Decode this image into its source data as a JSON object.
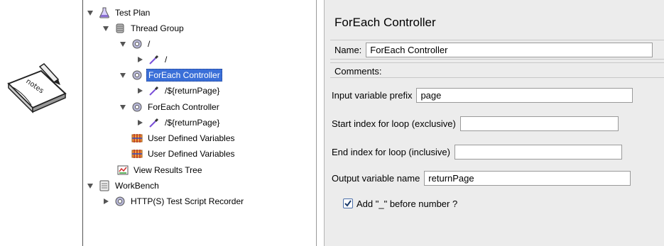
{
  "tree": {
    "items": [
      {
        "label": "Test Plan",
        "icon": "flask-icon",
        "toggle": "open"
      },
      {
        "label": "Thread Group",
        "icon": "spool-icon",
        "toggle": "open"
      },
      {
        "label": "/",
        "icon": "gear-icon",
        "toggle": "open"
      },
      {
        "label": "/",
        "icon": "pipette-icon",
        "toggle": "closed"
      },
      {
        "label": "ForEach Controller",
        "icon": "gear-icon",
        "toggle": "open",
        "selected": true
      },
      {
        "label": "/${returnPage}",
        "icon": "pipette-icon",
        "toggle": "closed"
      },
      {
        "label": "ForEach Controller",
        "icon": "gear-icon",
        "toggle": "open"
      },
      {
        "label": "/${returnPage}",
        "icon": "pipette-icon",
        "toggle": "closed"
      },
      {
        "label": "User Defined Variables",
        "icon": "variables-icon",
        "toggle": "none"
      },
      {
        "label": "User Defined Variables",
        "icon": "variables-icon",
        "toggle": "none"
      },
      {
        "label": "View Results Tree",
        "icon": "results-tree-icon",
        "toggle": "none"
      },
      {
        "label": "WorkBench",
        "icon": "clipboard-icon",
        "toggle": "open"
      },
      {
        "label": "HTTP(S) Test Script Recorder",
        "icon": "gear-icon",
        "toggle": "closed"
      }
    ]
  },
  "panel": {
    "title": "ForEach Controller",
    "name_label": "Name:",
    "name_value": "ForEach Controller",
    "comments_label": "Comments:",
    "input_prefix_label": "Input variable prefix",
    "input_prefix_value": "page",
    "start_index_label": "Start index for loop (exclusive)",
    "start_index_value": "",
    "end_index_label": "End index for loop (inclusive)",
    "end_index_value": "",
    "output_var_label": "Output variable name",
    "output_var_value": "returnPage",
    "add_underscore_label": "Add \"_\" before number ?",
    "add_underscore_checked": true
  },
  "decoration": {
    "notes_text": "notes"
  },
  "colors": {
    "selection": "#3a6fd8",
    "panel_bg": "#ececec",
    "checkbox_accent": "#4a6ea9"
  }
}
